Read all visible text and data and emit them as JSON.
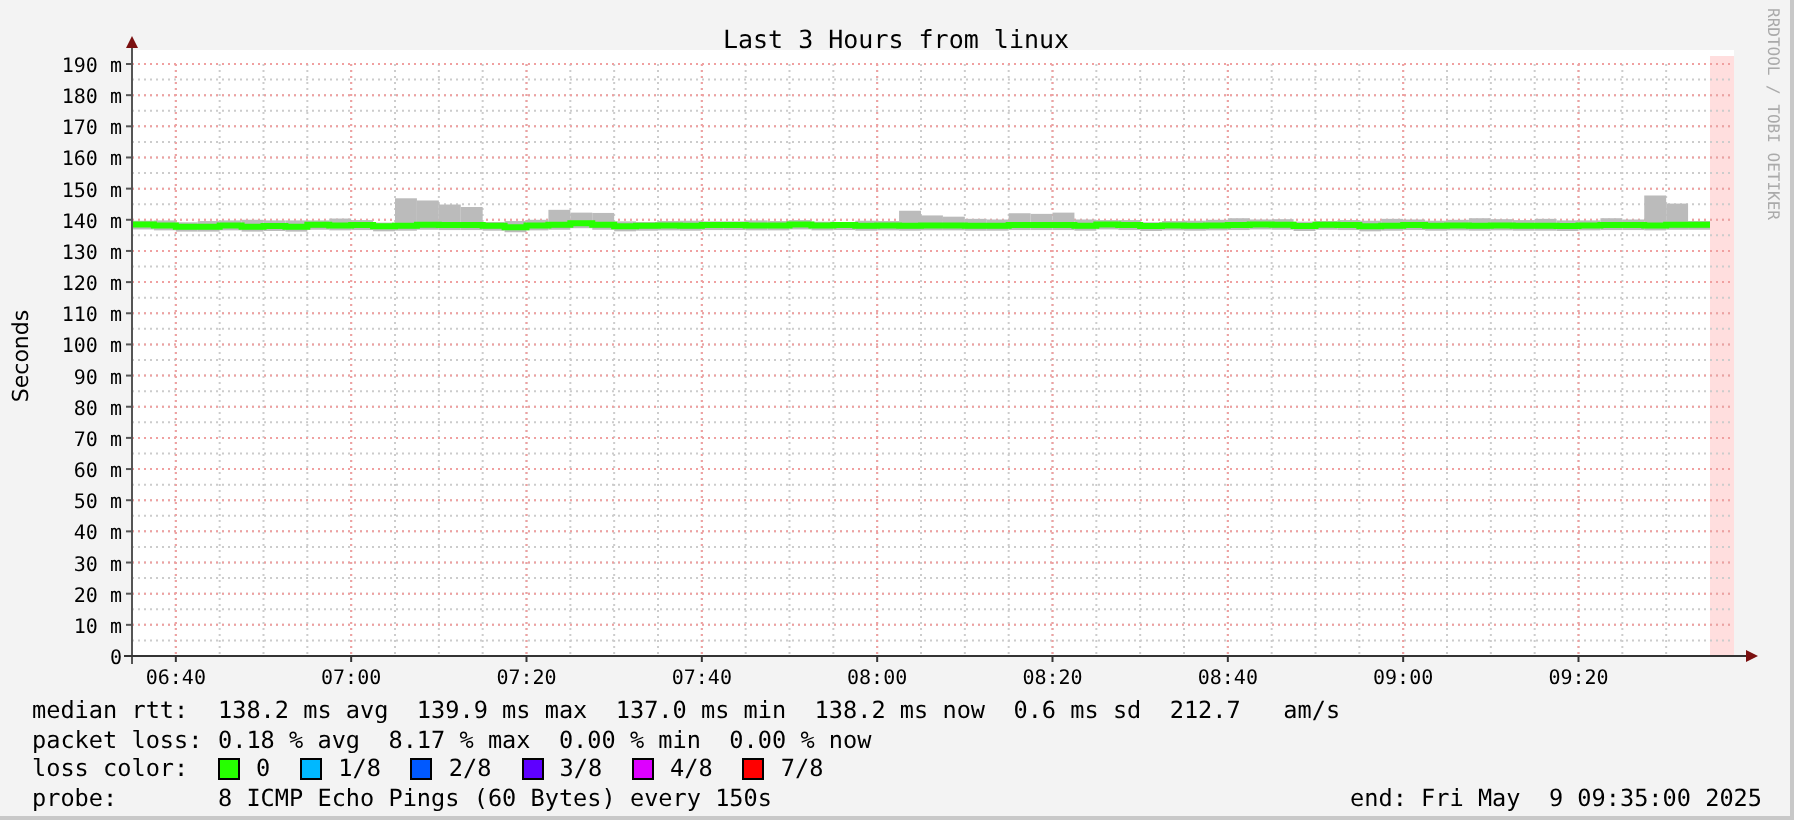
{
  "graph": {
    "credit": "RRDTOOL / TOBI OETIKER",
    "chart_data": {
      "type": "line",
      "title": "Last 3 Hours from linux",
      "ylabel": "Seconds",
      "ylim": [
        0,
        190
      ],
      "grid": true,
      "yticks": [
        {
          "value": 0,
          "label": "0"
        },
        {
          "value": 10,
          "label": "10 m"
        },
        {
          "value": 20,
          "label": "20 m"
        },
        {
          "value": 30,
          "label": "30 m"
        },
        {
          "value": 40,
          "label": "40 m"
        },
        {
          "value": 50,
          "label": "50 m"
        },
        {
          "value": 60,
          "label": "60 m"
        },
        {
          "value": 70,
          "label": "70 m"
        },
        {
          "value": 80,
          "label": "80 m"
        },
        {
          "value": 90,
          "label": "90 m"
        },
        {
          "value": 100,
          "label": "100 m"
        },
        {
          "value": 110,
          "label": "110 m"
        },
        {
          "value": 120,
          "label": "120 m"
        },
        {
          "value": 130,
          "label": "130 m"
        },
        {
          "value": 140,
          "label": "140 m"
        },
        {
          "value": 150,
          "label": "150 m"
        },
        {
          "value": 160,
          "label": "160 m"
        },
        {
          "value": 170,
          "label": "170 m"
        },
        {
          "value": 180,
          "label": "180 m"
        },
        {
          "value": 190,
          "label": "190 m"
        }
      ],
      "categories": [
        null,
        null,
        "06:40",
        null,
        null,
        null,
        null,
        null,
        null,
        null,
        "07:00",
        null,
        null,
        null,
        null,
        null,
        null,
        null,
        "07:20",
        null,
        null,
        null,
        null,
        null,
        null,
        null,
        "07:40",
        null,
        null,
        null,
        null,
        null,
        null,
        null,
        "08:00",
        null,
        null,
        null,
        null,
        null,
        null,
        null,
        "08:20",
        null,
        null,
        null,
        null,
        null,
        null,
        null,
        "08:40",
        null,
        null,
        null,
        null,
        null,
        null,
        null,
        "09:00",
        null,
        null,
        null,
        null,
        null,
        null,
        null,
        "09:20",
        null,
        null,
        null,
        null,
        null
      ],
      "series": [
        {
          "color": "#26ff00",
          "values": [
            138.5,
            138.2,
            137.8,
            137.8,
            138.2,
            137.8,
            138.0,
            137.8,
            138.4,
            138.2,
            138.3,
            137.9,
            138.1,
            138.4,
            138.3,
            138.3,
            138.1,
            137.6,
            138.2,
            138.4,
            138.9,
            138.4,
            137.9,
            138.1,
            138.2,
            138.1,
            138.3,
            138.3,
            138.2,
            138.2,
            138.5,
            138.2,
            138.3,
            138.1,
            138.2,
            138.1,
            138.2,
            138.2,
            138.1,
            138.1,
            138.3,
            138.3,
            138.3,
            138.1,
            138.5,
            138.3,
            138.0,
            138.2,
            138.1,
            138.2,
            138.3,
            138.5,
            138.4,
            138.0,
            138.4,
            138.3,
            137.9,
            138.1,
            138.3,
            138.1,
            138.2,
            138.1,
            138.2,
            138.1,
            138.1,
            138.0,
            138.2,
            138.3,
            138.3,
            138.2,
            138.4,
            138.4
          ]
        }
      ]
    }
  },
  "legend": {
    "median_rtt": {
      "label": "median rtt:",
      "text": "138.2 ms avg  139.9 ms max  137.0 ms min  138.2 ms now  0.6 ms sd  212.7   am/s"
    },
    "packet_loss": {
      "label": "packet loss:",
      "text": "0.18 % avg  8.17 % max  0.00 % min  0.00 % now"
    },
    "loss_color": {
      "label": "loss color:",
      "items": [
        {
          "label": "0",
          "color": "#26ff00"
        },
        {
          "label": "1/8",
          "color": "#00b8ff"
        },
        {
          "label": "2/8",
          "color": "#0059ff"
        },
        {
          "label": "3/8",
          "color": "#5e00ff"
        },
        {
          "label": "4/8",
          "color": "#dd00ff"
        },
        {
          "label": "7/8",
          "color": "#ff0000"
        }
      ]
    },
    "probe": {
      "label": "probe:",
      "text": "8 ICMP Echo Pings (60 Bytes) every 150s"
    },
    "end": "end: Fri May  9 09:35:00 2025"
  }
}
